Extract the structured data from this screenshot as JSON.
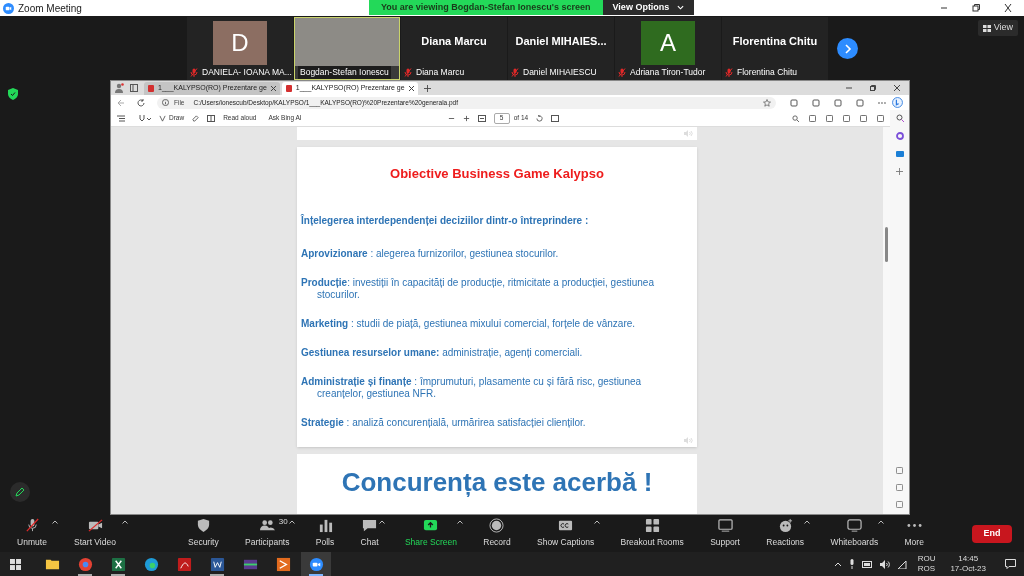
{
  "window": {
    "title": "Zoom Meeting"
  },
  "share_banner": {
    "text": "You are viewing Bogdan-Stefan Ionescu's screen",
    "button": "View Options"
  },
  "participants": [
    {
      "kind": "avatar",
      "initial": "D",
      "color": "#8c6e62",
      "name": "DANIELA- IOANA MA...",
      "muted": true,
      "speaking": false
    },
    {
      "kind": "video",
      "name": "Bogdan-Stefan Ionescu",
      "muted": false,
      "speaking": true
    },
    {
      "kind": "name",
      "display": "Diana Marcu",
      "name": "Diana Marcu",
      "muted": true,
      "speaking": false
    },
    {
      "kind": "name",
      "display": "Daniel  MIHAIES...",
      "name": "Daniel MIHAIESCU",
      "muted": true,
      "speaking": false
    },
    {
      "kind": "avatar",
      "initial": "A",
      "color": "#2f6b1f",
      "name": "Adriana Tiron-Tudor",
      "muted": true,
      "speaking": false
    },
    {
      "kind": "name",
      "display": "Florentina Chitu",
      "name": "Florentina Chitu",
      "muted": true,
      "speaking": false
    }
  ],
  "view_button": "View",
  "browser": {
    "tabs": [
      {
        "label": "1___KALYPSO(RO) Prezentare ge",
        "selected": false
      },
      {
        "label": "1___KALYPSO(RO) Prezentare ge",
        "selected": true
      }
    ],
    "address": {
      "scheme": "File",
      "url": "C:/Users/ionescub/Desktop/KALYPSO/1___KALYPSO(RO)%20Prezentare%20generala.pdf"
    },
    "pdf_toolbar": {
      "draw": "Draw",
      "read_aloud": "Read aloud",
      "ask": "Ask Bing AI",
      "page": "5",
      "page_count": "of 14"
    },
    "slide": {
      "title": "Obiective Business Game Kalypso",
      "paragraphs": [
        {
          "kind": "heading",
          "text": "Înțelegerea interdependenței deciziilor dintr-o întreprindere :"
        },
        {
          "kind": "item",
          "text": "**Aprovizionare** : alegerea furnizorilor, gestiunea stocurilor."
        },
        {
          "kind": "item",
          "text": "**Producție**: investiții în capacități de producție, ritmicitate a producției, gestiunea stocurilor."
        },
        {
          "kind": "item",
          "text": "**Marketing** : studii de piață, gestiunea mixului comercial, forțele de vânzare."
        },
        {
          "kind": "item",
          "text": "**Gestiunea resurselor umane:**  administrație,  agenți comerciali."
        },
        {
          "kind": "item",
          "text": "**Administrație și finanțe** : împrumuturi, plasamente cu și fără risc, gestiunea creanțelor, gestiunea NFR."
        },
        {
          "kind": "item",
          "text": "**Strategie** : analiză concurențială, urmărirea satisfacției clienților."
        }
      ]
    },
    "next_slide": {
      "title": "Concurența este acerbă !"
    }
  },
  "toolbar": {
    "buttons": [
      {
        "label": "Unmute",
        "menu": true
      },
      {
        "label": "Start Video",
        "menu": true
      },
      {
        "label": "Security",
        "menu": false
      },
      {
        "label": "Participants",
        "count": "30",
        "menu": true
      },
      {
        "label": "Polls",
        "menu": false
      },
      {
        "label": "Chat",
        "menu": true
      },
      {
        "label": "Share Screen",
        "menu": true,
        "highlight": true
      },
      {
        "label": "Record",
        "menu": false
      },
      {
        "label": "Show Captions",
        "menu": true
      },
      {
        "label": "Breakout Rooms",
        "menu": false
      },
      {
        "label": "Support",
        "menu": false
      },
      {
        "label": "Reactions",
        "menu": true
      },
      {
        "label": "Whiteboards",
        "menu": true
      },
      {
        "label": "More",
        "menu": false
      }
    ],
    "end": "End"
  },
  "taskbar": {
    "apps": [
      {
        "running": false,
        "active": false
      },
      {
        "running": true,
        "active": false
      },
      {
        "running": true,
        "active": false
      },
      {
        "running": false,
        "active": false
      },
      {
        "running": false,
        "active": false
      },
      {
        "running": true,
        "active": false
      },
      {
        "running": false,
        "active": false
      },
      {
        "running": false,
        "active": false
      },
      {
        "running": true,
        "active": true
      }
    ],
    "language": "ROU",
    "layout": "ROS",
    "time": "14:45",
    "date": "17-Oct-23"
  }
}
